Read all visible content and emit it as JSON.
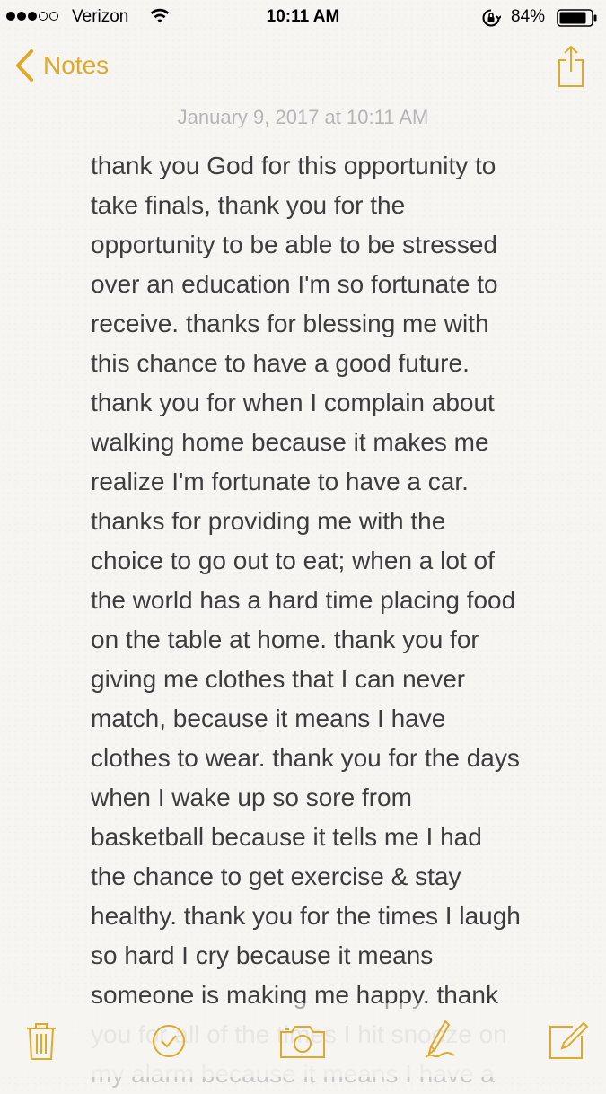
{
  "status_bar": {
    "carrier": "Verizon",
    "time": "10:11 AM",
    "battery": "84%",
    "signal_bars_filled": 3,
    "signal_bars_total": 5
  },
  "nav": {
    "back_label": "Notes",
    "back_icon": "chevron-left-icon",
    "share_icon": "share-icon"
  },
  "note": {
    "date": "January 9, 2017 at 10:11 AM",
    "lines": [
      "thank you God for this opportunity to",
      "take finals, thank you for the",
      "opportunity to be able to be stressed",
      "over an education I'm so fortunate to",
      "receive. thanks for blessing me with",
      "this chance to have a good future.",
      "thank you for when I complain about",
      "walking home because it makes me",
      "realize I'm fortunate to have a car.",
      "thanks for providing me with the",
      "choice to go out to eat; when a lot of",
      "the world has a hard time placing food",
      "on the table at home. thank you for",
      "giving me clothes that I can never",
      "match, because it means I have",
      "clothes to wear. thank you for the days",
      "when I wake up so sore from",
      "basketball because it tells me I had",
      "the chance to get exercise & stay",
      "healthy. thank you for the times I laugh",
      "so hard I cry because it means",
      "someone is making me happy. thank",
      "you for all of the times I hit snooze on",
      "my alarm because it means I have a"
    ]
  },
  "toolbar": {
    "items": [
      "trash-icon",
      "checklist-icon",
      "camera-icon",
      "sketch-icon",
      "compose-icon"
    ]
  },
  "colors": {
    "accent": "#e0a92a",
    "text": "#3d3d3d",
    "date": "#b5b5b5",
    "background": "#f6f5f2"
  }
}
